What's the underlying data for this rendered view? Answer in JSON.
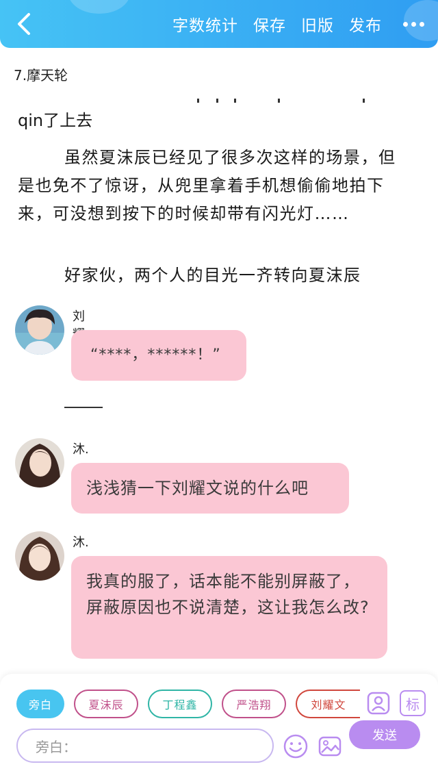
{
  "header": {
    "back_icon": "chevron-left-icon",
    "actions": [
      "字数统计",
      "保存",
      "旧版",
      "发布"
    ],
    "more_icon": "more-dots-icon",
    "colors": {
      "gradient_start": "#46c3f5",
      "gradient_end": "#2f9df2"
    }
  },
  "chapter": {
    "title": "7.摩天轮"
  },
  "story": {
    "paragraphs": [
      "qin了上去",
      "虽然夏沫辰已经见了很多次这样的场景，但是也免不了惊讶，从兜里拿着手机想偷偷地拍下来，可没想到按下的时候却带有闪光灯……",
      "好家伙，两个人的目光一齐转向夏沫辰"
    ]
  },
  "messages": [
    {
      "sender": "刘耀文",
      "text": "“****，******！”"
    },
    {
      "sender": "沐.",
      "text": "浅浅猜一下刘耀文说的什么吧"
    },
    {
      "sender": "沐.",
      "text": "我真的服了，话本能不能别屏蔽了，屏蔽原因也不说清楚，这让我怎么改?"
    }
  ],
  "bottom": {
    "roles": [
      "旁白",
      "夏沫辰",
      "丁程鑫",
      "严浩翔",
      "刘耀文"
    ],
    "role_colors": [
      "#48c5f0",
      "#c0508a",
      "#2fb5a6",
      "#c0508a",
      "#d0463c"
    ],
    "role_icon": "person-card-icon",
    "tag_label": "标",
    "input_placeholder": "旁白：",
    "emoji_icon": "smiley-icon",
    "image_icon": "image-icon",
    "send_label": "发送",
    "accent": "#b98cf0",
    "bubble_color": "#fbc7d4"
  }
}
